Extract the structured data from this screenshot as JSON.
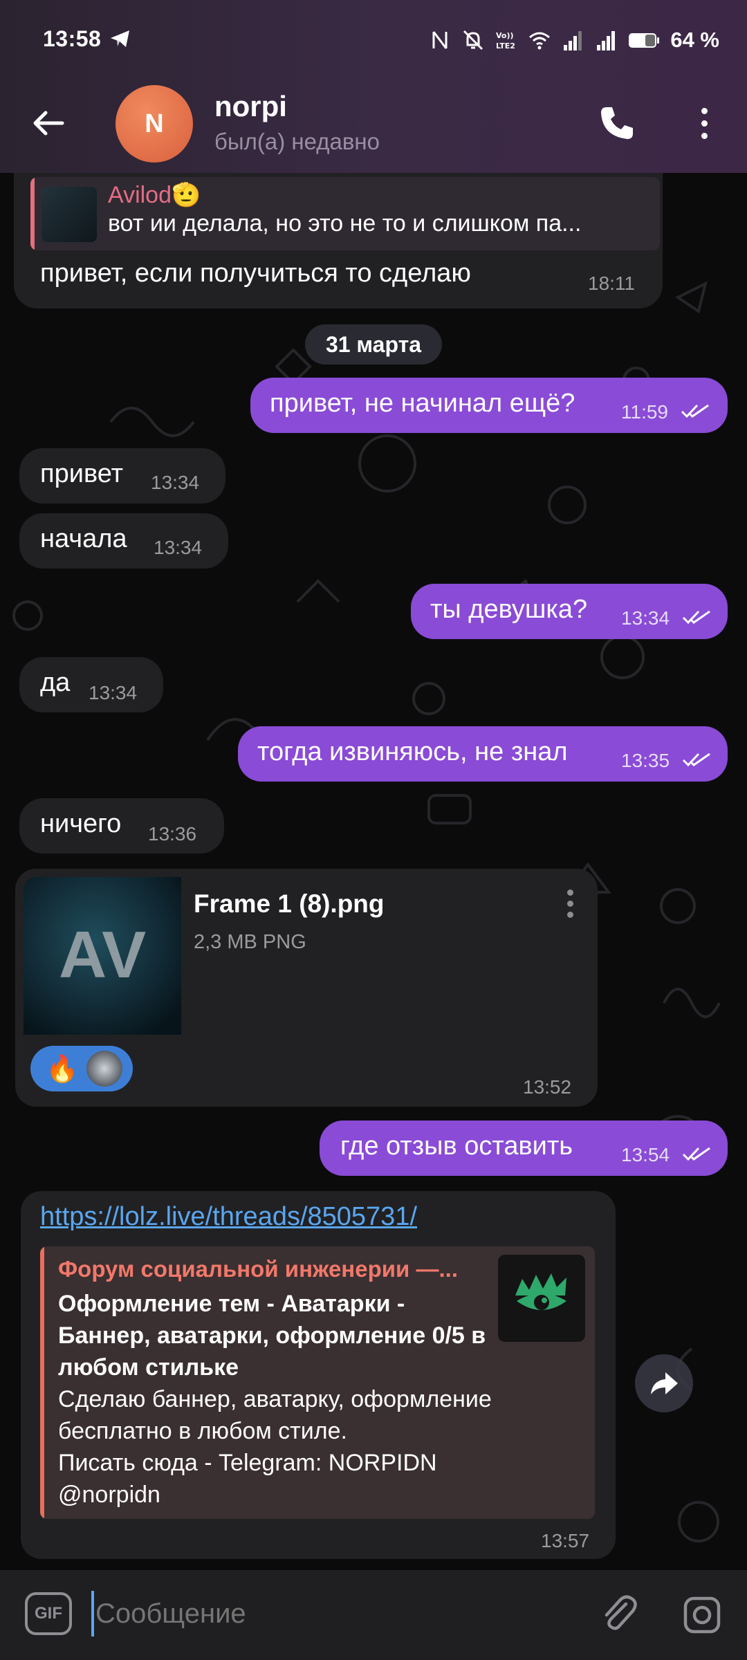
{
  "status_bar": {
    "time": "13:58",
    "battery": "64 %",
    "icons": [
      "telegram-send-icon",
      "nfc-icon",
      "mute-icon",
      "volte-icon",
      "wifi-icon",
      "signal-icon",
      "signal-icon",
      "battery-icon"
    ]
  },
  "header": {
    "avatar_letter": "N",
    "name": "norpi",
    "status": "был(а) недавно",
    "avatar_color": "#e0683f"
  },
  "colors": {
    "outgoing_bubble": "#8a4bd6",
    "incoming_bubble": "#212123",
    "link": "#5aa6f0",
    "reaction_pill": "#3d7fd7"
  },
  "messages": {
    "m1": {
      "reply_author": "Avilod🫡",
      "reply_text": "вот ии делала, но это не то и слишком па...",
      "text": "привет, если получиться то сделаю",
      "time": "18:11"
    },
    "date_separator": "31 марта",
    "m2": {
      "text": "привет, не начинал ещё?",
      "time": "11:59"
    },
    "m3": {
      "text": "привет",
      "time": "13:34"
    },
    "m4": {
      "text": "начала",
      "time": "13:34"
    },
    "m5": {
      "text": "ты девушка?",
      "time": "13:34"
    },
    "m6": {
      "text": "да",
      "time": "13:34"
    },
    "m7": {
      "text": "тогда извиняюсь, не знал",
      "time": "13:35"
    },
    "m8": {
      "text": "ничего",
      "time": "13:36"
    },
    "m9": {
      "file_name": "Frame 1 (8).png",
      "file_meta": "2,3 MB PNG",
      "thumb_text": "AV",
      "reaction_emoji": "🔥",
      "time": "13:52"
    },
    "m10": {
      "text": "где отзыв оставить",
      "time": "13:54"
    },
    "m11": {
      "url": "https://lolz.live/threads/8505731/",
      "preview_site": "Форум социальной инженерии —...",
      "preview_title": "Оформление тем - Аватарки - Баннер, аватарки, оформление 0/5 в любом стильке",
      "preview_desc": "Сделаю баннер, аватарку, оформление\nбесплатно в любом стиле.\nПисать сюда - Telegram: NORPIDN\n@norpidn",
      "time": "13:57"
    }
  },
  "input": {
    "gif_label": "GIF",
    "placeholder": "Сообщение"
  }
}
